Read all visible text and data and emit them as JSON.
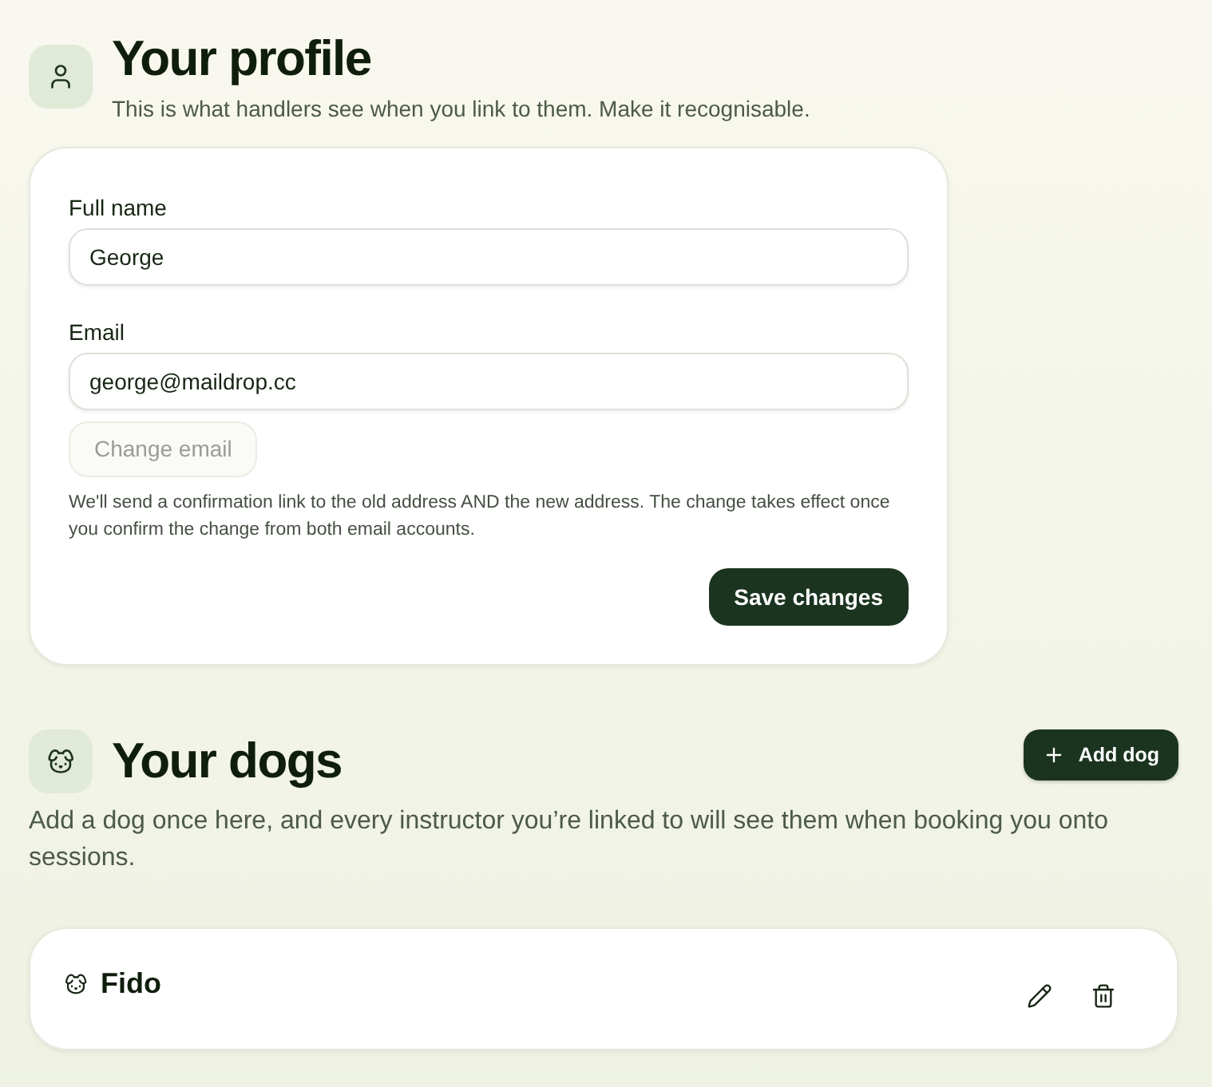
{
  "profile": {
    "title": "Your profile",
    "subtitle": "This is what handlers see when you link to them. Make it recognisable.",
    "fields": [
      {
        "label": "Full name",
        "value": "George"
      },
      {
        "label": "Email",
        "value": "george@maildrop.cc"
      }
    ],
    "change_email": {
      "label": "Change email",
      "disabled": true
    },
    "note": "We'll send a confirmation link to the old address AND the new address. The change takes effect once you confirm the change from both email accounts.",
    "save_button": "Save changes"
  },
  "dogs": {
    "title": "Your dogs",
    "add_button": "Add dog",
    "description": "Add a dog once here, and every instructor you’re linked to will see them when booking you onto sessions.",
    "items": [
      {
        "name": "Fido"
      }
    ]
  }
}
